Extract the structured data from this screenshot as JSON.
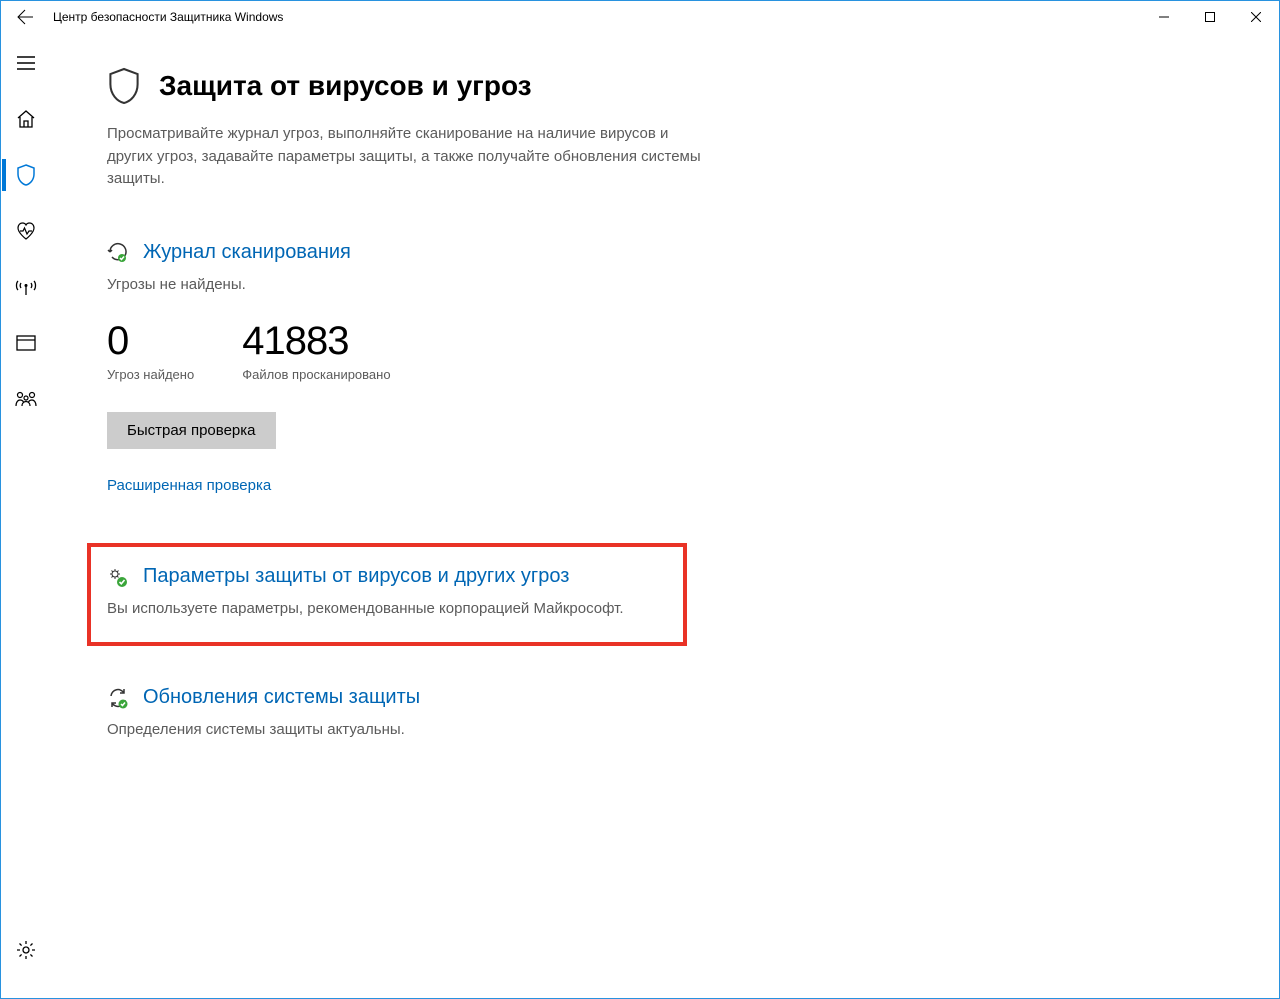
{
  "window": {
    "title": "Центр безопасности Защитника Windows"
  },
  "page": {
    "title": "Защита от вирусов и угроз",
    "description": "Просматривайте журнал угроз, выполняйте сканирование на наличие вирусов и других угроз, задавайте параметры защиты, а также получайте обновления системы защиты."
  },
  "scan_history": {
    "title": "Журнал сканирования",
    "status": "Угрозы не найдены.",
    "threats_count": "0",
    "threats_label": "Угроз найдено",
    "files_count": "41883",
    "files_label": "Файлов просканировано",
    "quick_scan_btn": "Быстрая проверка",
    "advanced_scan_link": "Расширенная проверка"
  },
  "protection_settings": {
    "title": "Параметры защиты от вирусов и других угроз",
    "description": "Вы используете параметры, рекомендованные корпорацией Майкрософт."
  },
  "protection_updates": {
    "title": "Обновления системы защиты",
    "description": "Определения системы защиты актуальны."
  }
}
